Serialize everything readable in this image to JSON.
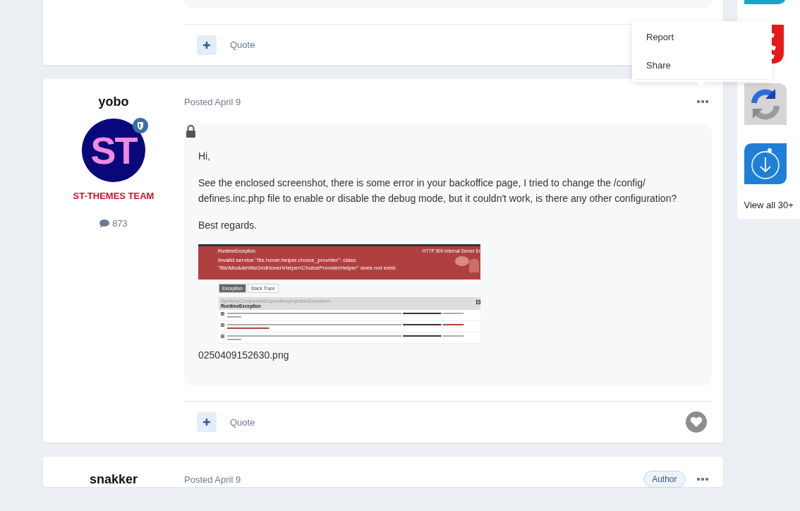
{
  "top_post": {
    "quote": "Quote"
  },
  "posts": [
    {
      "author": "yobo",
      "avatar": "ST",
      "group": "ST-THEMES TEAM",
      "post_count": "873",
      "date": "Posted April 9",
      "locked": true,
      "paragraphs": [
        "Hi,",
        "See the enclosed screenshot, there is some error in your backoffice page, I tried to change the /config/ defines.inc.php file to enable or disable the debug mode, but it couldn't work, is there any other configuration?",
        "Best regards."
      ],
      "attachment": {
        "filename": "0250409152630.png",
        "screenshot": {
          "title": "RuntimeException",
          "status": "HTTP 500 Internal Server Er",
          "message": "Invalid service \"itis.hover.helper.choice_provider\": class \"Itis\\Module\\ItisGridHover\\Helper\\ChoiceProviderHelper\" does not exist.",
          "tabs": [
            {
              "label": "Exception",
              "selected": true
            },
            {
              "label": "Stack Trace",
              "selected": false
            }
          ],
          "namespace": "Symfony\\Component\\DependencyInjection\\Exception\\",
          "exception": "RuntimeException"
        }
      },
      "quote": "Quote",
      "liked": false
    },
    {
      "author": "snakker",
      "date": "Posted April 9",
      "badge": "Author"
    }
  ],
  "menu": {
    "items": [
      "Report",
      "Share"
    ]
  },
  "sidebar": {
    "link": "View all 30+"
  }
}
